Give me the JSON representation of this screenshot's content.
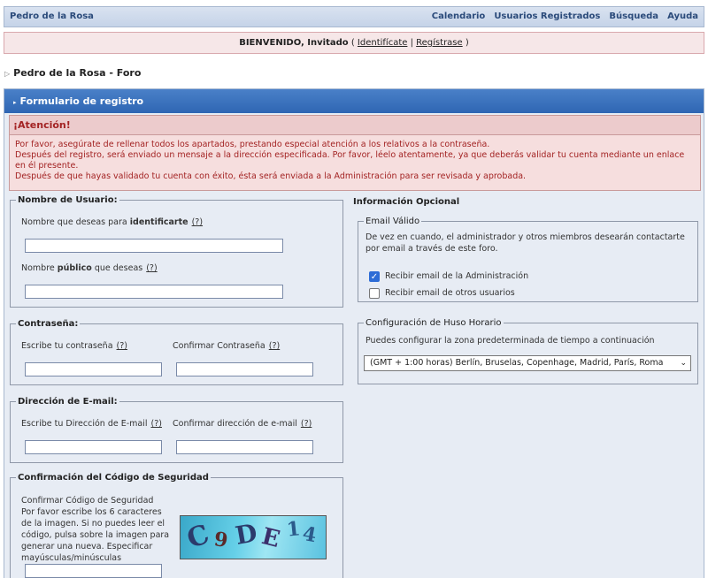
{
  "header": {
    "site_name": "Pedro de la Rosa",
    "nav": [
      "Calendario",
      "Usuarios Registrados",
      "Búsqueda",
      "Ayuda"
    ]
  },
  "welcome": {
    "greeting": "BIENVENIDO, Invitado",
    "open": "(",
    "login": "Identifícate",
    "sep": "|",
    "register": "Regístrase",
    "close": ")"
  },
  "breadcrumb": "Pedro de la Rosa - Foro",
  "panel": {
    "title": "Formulario de registro",
    "alert_title": "¡Atención!",
    "alert_lines": [
      "Por favor, asegúrate de rellenar todos los apartados, prestando especial atención a los relativos a la contraseña.",
      "Después del registro, será enviado un mensaje a la dirección especificada. Por favor, léelo atentamente, ya que deberás validar tu cuenta mediante un enlace en él presente.",
      "Después de que hayas validado tu cuenta con éxito, ésta será enviada a la Administración para ser revisada y aprobada."
    ]
  },
  "username": {
    "legend": "Nombre de Usuario:",
    "identify_pre": "Nombre que deseas para",
    "identify_bold": "identificarte",
    "public_pre": "Nombre",
    "public_bold": "público",
    "public_post": "que deseas",
    "help": "(?)"
  },
  "password": {
    "legend": "Contraseña:",
    "write": "Escribe tu contraseña",
    "confirm": "Confirmar Contraseña",
    "help": "(?)"
  },
  "email": {
    "legend": "Dirección de E-mail:",
    "write": "Escribe tu Dirección de E-mail",
    "confirm": "Confirmar dirección de e-mail",
    "help": "(?)"
  },
  "captcha": {
    "legend": "Confirmación del Código de Seguridad",
    "label": "Confirmar Código de Seguridad",
    "desc": "Por favor escribe los 6 caracteres de la imagen. Si no puedes leer el código, pulsa sobre la imagen para generar una nueva. Especificar mayúsculas/minúsculas",
    "chars": [
      "C",
      "9",
      "D",
      "E",
      "1",
      "4"
    ]
  },
  "optional": {
    "heading": "Información Opcional",
    "email_legend": "Email Válido",
    "email_desc": "De vez en cuando, el administrador y otros miembros desearán contactarte por email a través de este foro.",
    "chk_admin": "Recibir email de la Administración",
    "chk_admin_checked": true,
    "chk_users": "Recibir email de otros usuarios",
    "chk_users_checked": false,
    "tz_legend": "Configuración de Huso Horario",
    "tz_desc": "Puedes configurar la zona predeterminada de tiempo a continuación",
    "tz_value": "(GMT + 1:00 horas) Berlín, Bruselas, Copenhage, Madrid, París, Roma"
  },
  "colors": {
    "header_blue": "#2f66b3",
    "alert_red": "#a32323",
    "checkbox_blue": "#2d6cd6"
  }
}
